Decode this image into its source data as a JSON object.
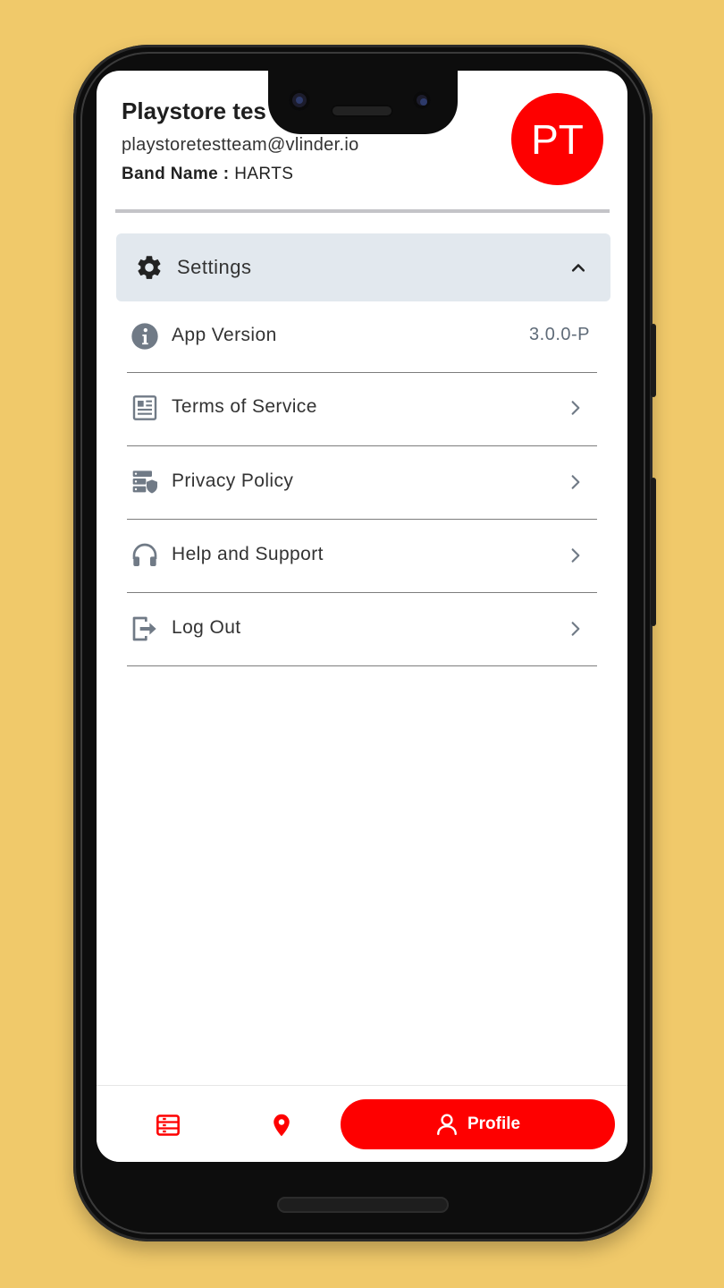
{
  "profile": {
    "name": "Playstore tes",
    "email": "playstoretestteam@vlinder.io",
    "band_label": "Band Name :",
    "band_value": "HARTS",
    "avatar_initials": "PT",
    "avatar_color": "#fe0000"
  },
  "settings": {
    "title": "Settings",
    "items": [
      {
        "label": "App Version",
        "value": "3.0.0-P",
        "icon": "info-icon"
      },
      {
        "label": "Terms of Service",
        "icon": "document-icon"
      },
      {
        "label": "Privacy Policy",
        "icon": "server-shield-icon"
      },
      {
        "label": "Help and Support",
        "icon": "headphones-icon"
      },
      {
        "label": "Log Out",
        "icon": "logout-icon"
      }
    ]
  },
  "bottom_nav": {
    "items": [
      {
        "icon": "list-icon"
      },
      {
        "icon": "location-pin-icon"
      },
      {
        "icon": "user-icon",
        "label": "Profile",
        "active": true
      }
    ]
  },
  "colors": {
    "accent": "#fe0000",
    "background": "#f0c96a",
    "settings_header_bg": "#e2e8ee"
  }
}
